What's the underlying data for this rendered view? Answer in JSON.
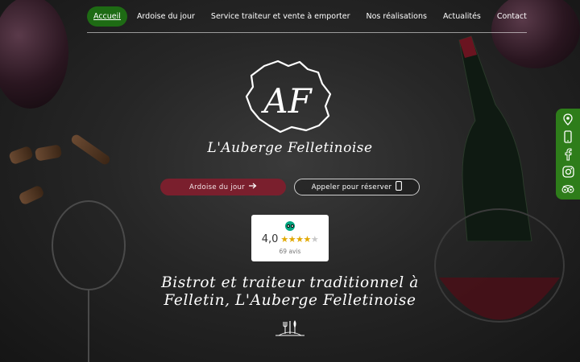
{
  "nav": {
    "items": [
      {
        "label": "Accueil",
        "active": true
      },
      {
        "label": "Ardoise du jour",
        "active": false
      },
      {
        "label": "Service traiteur et vente à emporter",
        "active": false
      },
      {
        "label": "Nos réalisations",
        "active": false
      },
      {
        "label": "Actualités",
        "active": false
      },
      {
        "label": "Contact",
        "active": false
      }
    ]
  },
  "logo": {
    "monogram": "AF"
  },
  "brand": {
    "name": "L'Auberge Felletinoise"
  },
  "buttons": {
    "ardoise": {
      "label": "Ardoise du jour",
      "icon": "arrow-right-icon"
    },
    "call": {
      "label": "Appeler pour réserver",
      "icon": "phone-icon"
    }
  },
  "rating": {
    "score": "4,0",
    "stars_value": 4,
    "stars_max": 5,
    "count": "69 avis",
    "provider_icon": "tripadvisor-icon"
  },
  "headline": {
    "line1": "Bistrot et traiteur traditionnel à",
    "line2": "Felletin, L'Auberge Felletinoise"
  },
  "side": {
    "icons": [
      "map-pin-icon",
      "phone-icon",
      "facebook-icon",
      "instagram-icon",
      "tripadvisor-icon"
    ]
  },
  "colors": {
    "nav_active": "#1e6b14",
    "ardoise_button": "#7a1f2d",
    "side_bar": "#2e7d1a",
    "star": "#e1a800"
  }
}
